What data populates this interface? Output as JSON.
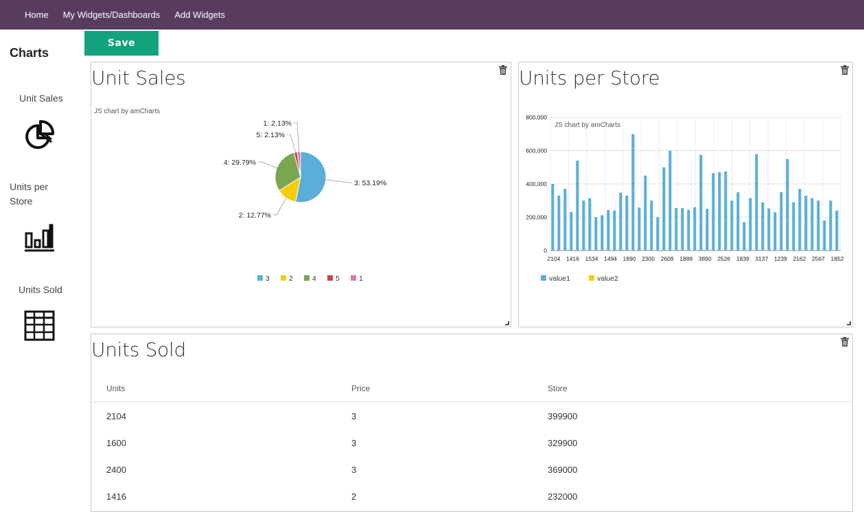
{
  "nav": {
    "items": [
      "Home",
      "My Widgets/Dashboards",
      "Add Widgets"
    ]
  },
  "sidebar": {
    "title": "Charts",
    "items": [
      {
        "label": "Unit Sales",
        "icon": "pie-chart-icon"
      },
      {
        "label": "Units per Store",
        "icon": "bar-chart-icon"
      },
      {
        "label": "Units Sold",
        "icon": "table-icon"
      }
    ]
  },
  "toolbar": {
    "save_label": "Save"
  },
  "colors": {
    "nav_bg": "#573c60",
    "save_bg": "#12a37d"
  },
  "widgets": {
    "pie": {
      "title": "Unit Sales",
      "credit": "JS chart by amCharts"
    },
    "bar": {
      "title": "Units per Store",
      "credit": "JS chart by amCharts"
    },
    "table": {
      "title": "Units Sold",
      "columns": [
        "Units",
        "Price",
        "Store"
      ],
      "rows": [
        [
          "2104",
          "3",
          "399900"
        ],
        [
          "1600",
          "3",
          "329900"
        ],
        [
          "2400",
          "3",
          "369000"
        ],
        [
          "1416",
          "2",
          "232000"
        ]
      ]
    }
  },
  "chart_data": [
    {
      "type": "pie",
      "title": "Unit Sales",
      "slices": [
        {
          "name": "3",
          "value": 53.19,
          "label": "3: 53.19%",
          "color": "#5aaed8"
        },
        {
          "name": "2",
          "value": 12.77,
          "label": "2: 12.77%",
          "color": "#f7cc0a"
        },
        {
          "name": "4",
          "value": 29.79,
          "label": "4: 29.79%",
          "color": "#78a74f"
        },
        {
          "name": "5",
          "value": 2.13,
          "label": "5: 2.13%",
          "color": "#d0434a"
        },
        {
          "name": "1",
          "value": 2.13,
          "label": "1: 2.13%",
          "color": "#d97ab0"
        }
      ],
      "legend": "bottom"
    },
    {
      "type": "bar",
      "title": "Units per Store",
      "tick_labels": [
        "2104",
        "1416",
        "1534",
        "1494",
        "1890",
        "2300",
        "2609",
        "1888",
        "3890",
        "2526",
        "1839",
        "3137",
        "1239",
        "2162",
        "2567",
        "1852"
      ],
      "series": [
        {
          "name": "value1",
          "color": "#5aaed8",
          "values": [
            400000,
            330000,
            370000,
            232000,
            540000,
            300000,
            315000,
            200000,
            212000,
            243000,
            240000,
            348000,
            330000,
            700000,
            258000,
            450000,
            300000,
            200000,
            500000,
            600000,
            255000,
            255000,
            245000,
            260000,
            575000,
            250000,
            465000,
            470000,
            475000,
            300000,
            350000,
            170000,
            315000,
            580000,
            290000,
            252000,
            230000,
            350000,
            550000,
            290000,
            370000,
            330000,
            315000,
            300000,
            180000,
            300000,
            240000
          ]
        },
        {
          "name": "value2",
          "color": "#f7cc0a",
          "values": []
        }
      ],
      "y_ticks": [
        "0",
        "200,000",
        "400,000",
        "600,000",
        "800,000"
      ],
      "ylim": [
        0,
        800000
      ],
      "grid": true,
      "legend": "bottom-left"
    }
  ]
}
